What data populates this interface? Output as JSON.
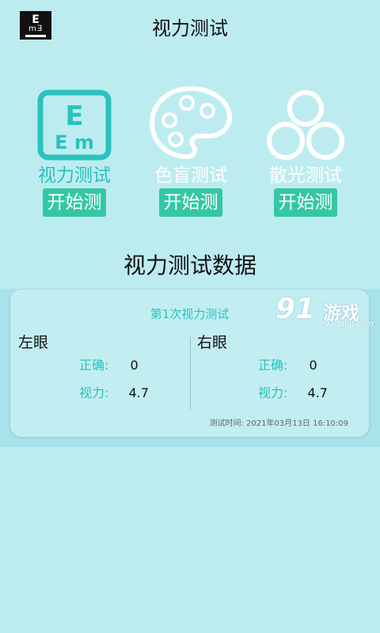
{
  "header": {
    "title": "视力测试",
    "logo": {
      "letter": "E",
      "sub": "m∃"
    }
  },
  "tools": [
    {
      "label": "视力测试",
      "button": "开始测",
      "icon": "eye-chart-icon",
      "label_color": "#2ac2bd"
    },
    {
      "label": "色盲测试",
      "button": "开始测",
      "icon": "palette-icon",
      "label_color": "#ffffff"
    },
    {
      "label": "散光测试",
      "button": "开始测",
      "icon": "circles-icon",
      "label_color": "#ffffff"
    }
  ],
  "section_title": "视力测试数据",
  "record": {
    "title": "第1次视力测试",
    "left_eye": {
      "title": "左眼",
      "correct_label": "正确:",
      "correct_value": "0",
      "vision_label": "视力:",
      "vision_value": "4.7"
    },
    "right_eye": {
      "title": "右眼",
      "correct_label": "正确:",
      "correct_value": "0",
      "vision_label": "视力:",
      "vision_value": "4.7"
    },
    "time": "测试时间: 2021年03月13日 16:10:09"
  },
  "watermark": {
    "brand": "91",
    "text": "游戏",
    "url": "91danji.com"
  },
  "colors": {
    "background": "#bdecf0",
    "accent": "#2ac2bd",
    "button": "#35c7a5"
  }
}
